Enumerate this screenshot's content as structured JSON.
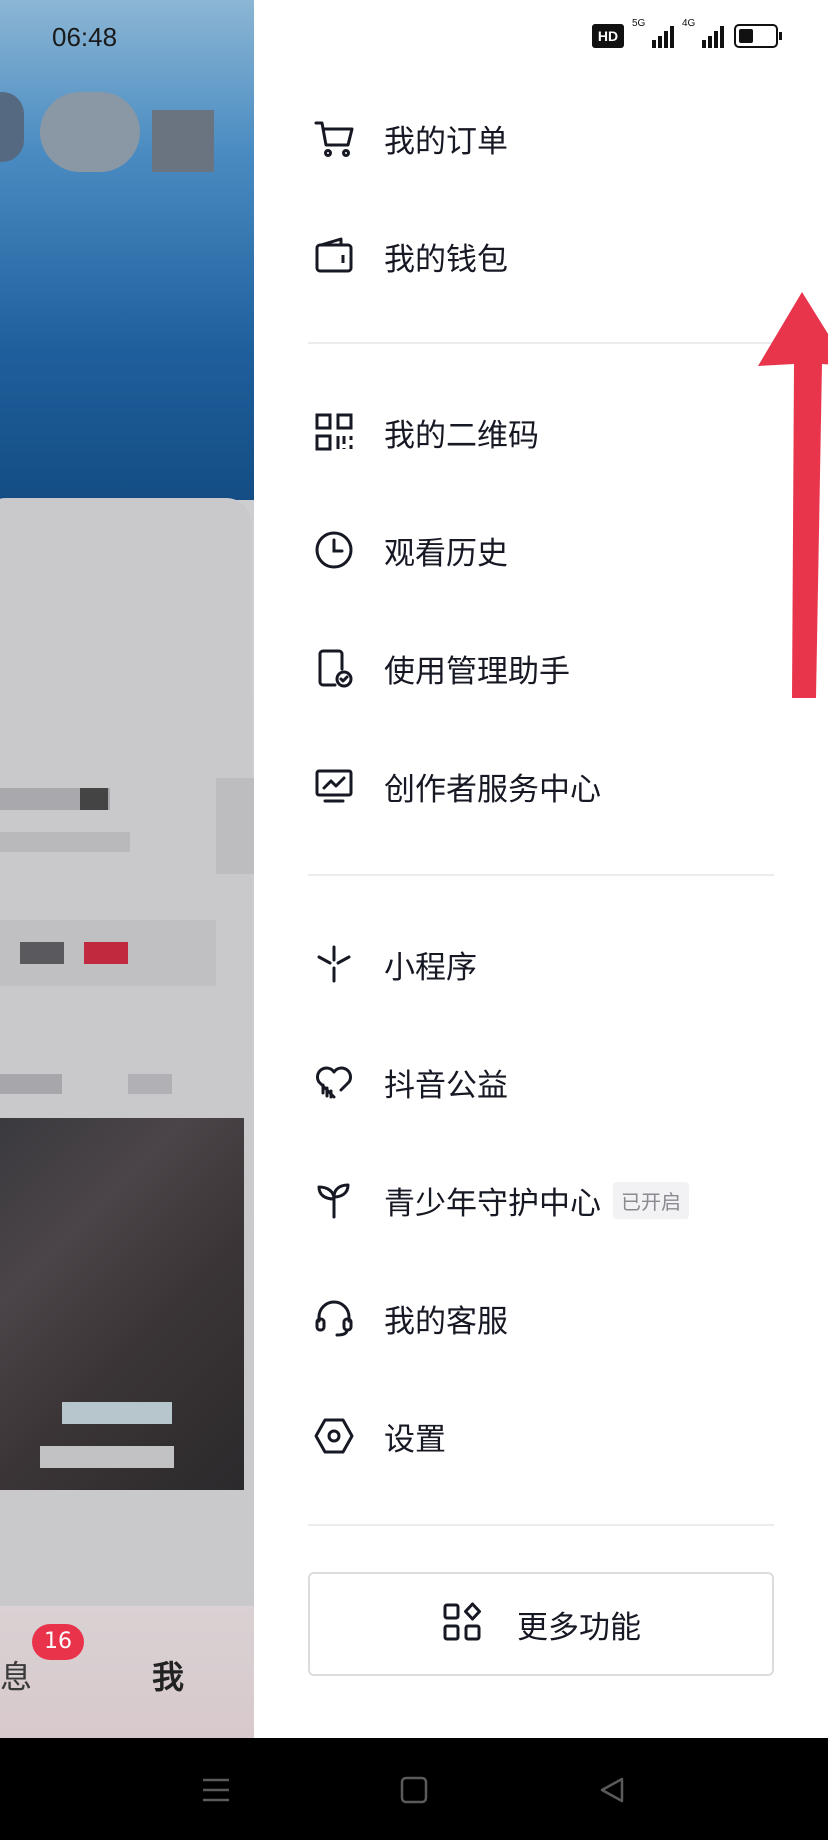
{
  "status": {
    "time": "06:48",
    "hd": "HD",
    "net1": "5G",
    "net2": "4G"
  },
  "bottom_tabs": {
    "messages": "息",
    "messages_badge": "16",
    "me": "我"
  },
  "menu": {
    "group1": [
      {
        "label": "我的订单",
        "icon": "cart-icon"
      },
      {
        "label": "我的钱包",
        "icon": "wallet-icon"
      }
    ],
    "group2": [
      {
        "label": "我的二维码",
        "icon": "qr-code-icon"
      },
      {
        "label": "观看历史",
        "icon": "clock-icon"
      },
      {
        "label": "使用管理助手",
        "icon": "phone-check-icon"
      },
      {
        "label": "创作者服务中心",
        "icon": "monitor-chart-icon"
      }
    ],
    "group3": [
      {
        "label": "小程序",
        "icon": "mini-program-icon"
      },
      {
        "label": "抖音公益",
        "icon": "heart-hand-icon"
      },
      {
        "label": "青少年守护中心",
        "icon": "sprout-icon",
        "tag": "已开启"
      },
      {
        "label": "我的客服",
        "icon": "headset-icon"
      },
      {
        "label": "设置",
        "icon": "settings-hex-icon"
      }
    ],
    "more_button": {
      "label": "更多功能",
      "icon": "grid-plus-icon"
    }
  },
  "colors": {
    "arrow": "#e8354c",
    "badge": "#e8334a",
    "text": "#161823",
    "divider": "#ececee"
  }
}
